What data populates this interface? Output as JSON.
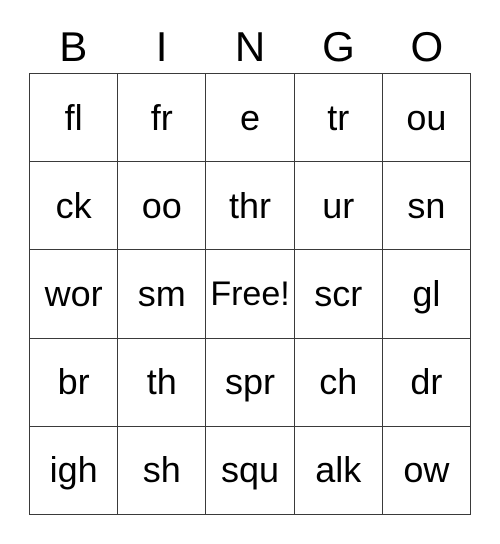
{
  "card": {
    "title": "BINGO",
    "header_letters": [
      "B",
      "I",
      "N",
      "G",
      "O"
    ],
    "free_space_label": "Free!",
    "text_color": "#000000",
    "border_color": "#3a3a3a",
    "background_color": "#ffffff",
    "grid_size": "5x5",
    "rows": [
      {
        "cells": [
          "fl",
          "fr",
          "e",
          "tr",
          "ou"
        ]
      },
      {
        "cells": [
          "ck",
          "oo",
          "thr",
          "ur",
          "sn"
        ]
      },
      {
        "cells": [
          "wor",
          "sm",
          "Free!",
          "scr",
          "gl"
        ]
      },
      {
        "cells": [
          "br",
          "th",
          "spr",
          "ch",
          "dr"
        ]
      },
      {
        "cells": [
          "igh",
          "sh",
          "squ",
          "alk",
          "ow"
        ]
      }
    ]
  }
}
